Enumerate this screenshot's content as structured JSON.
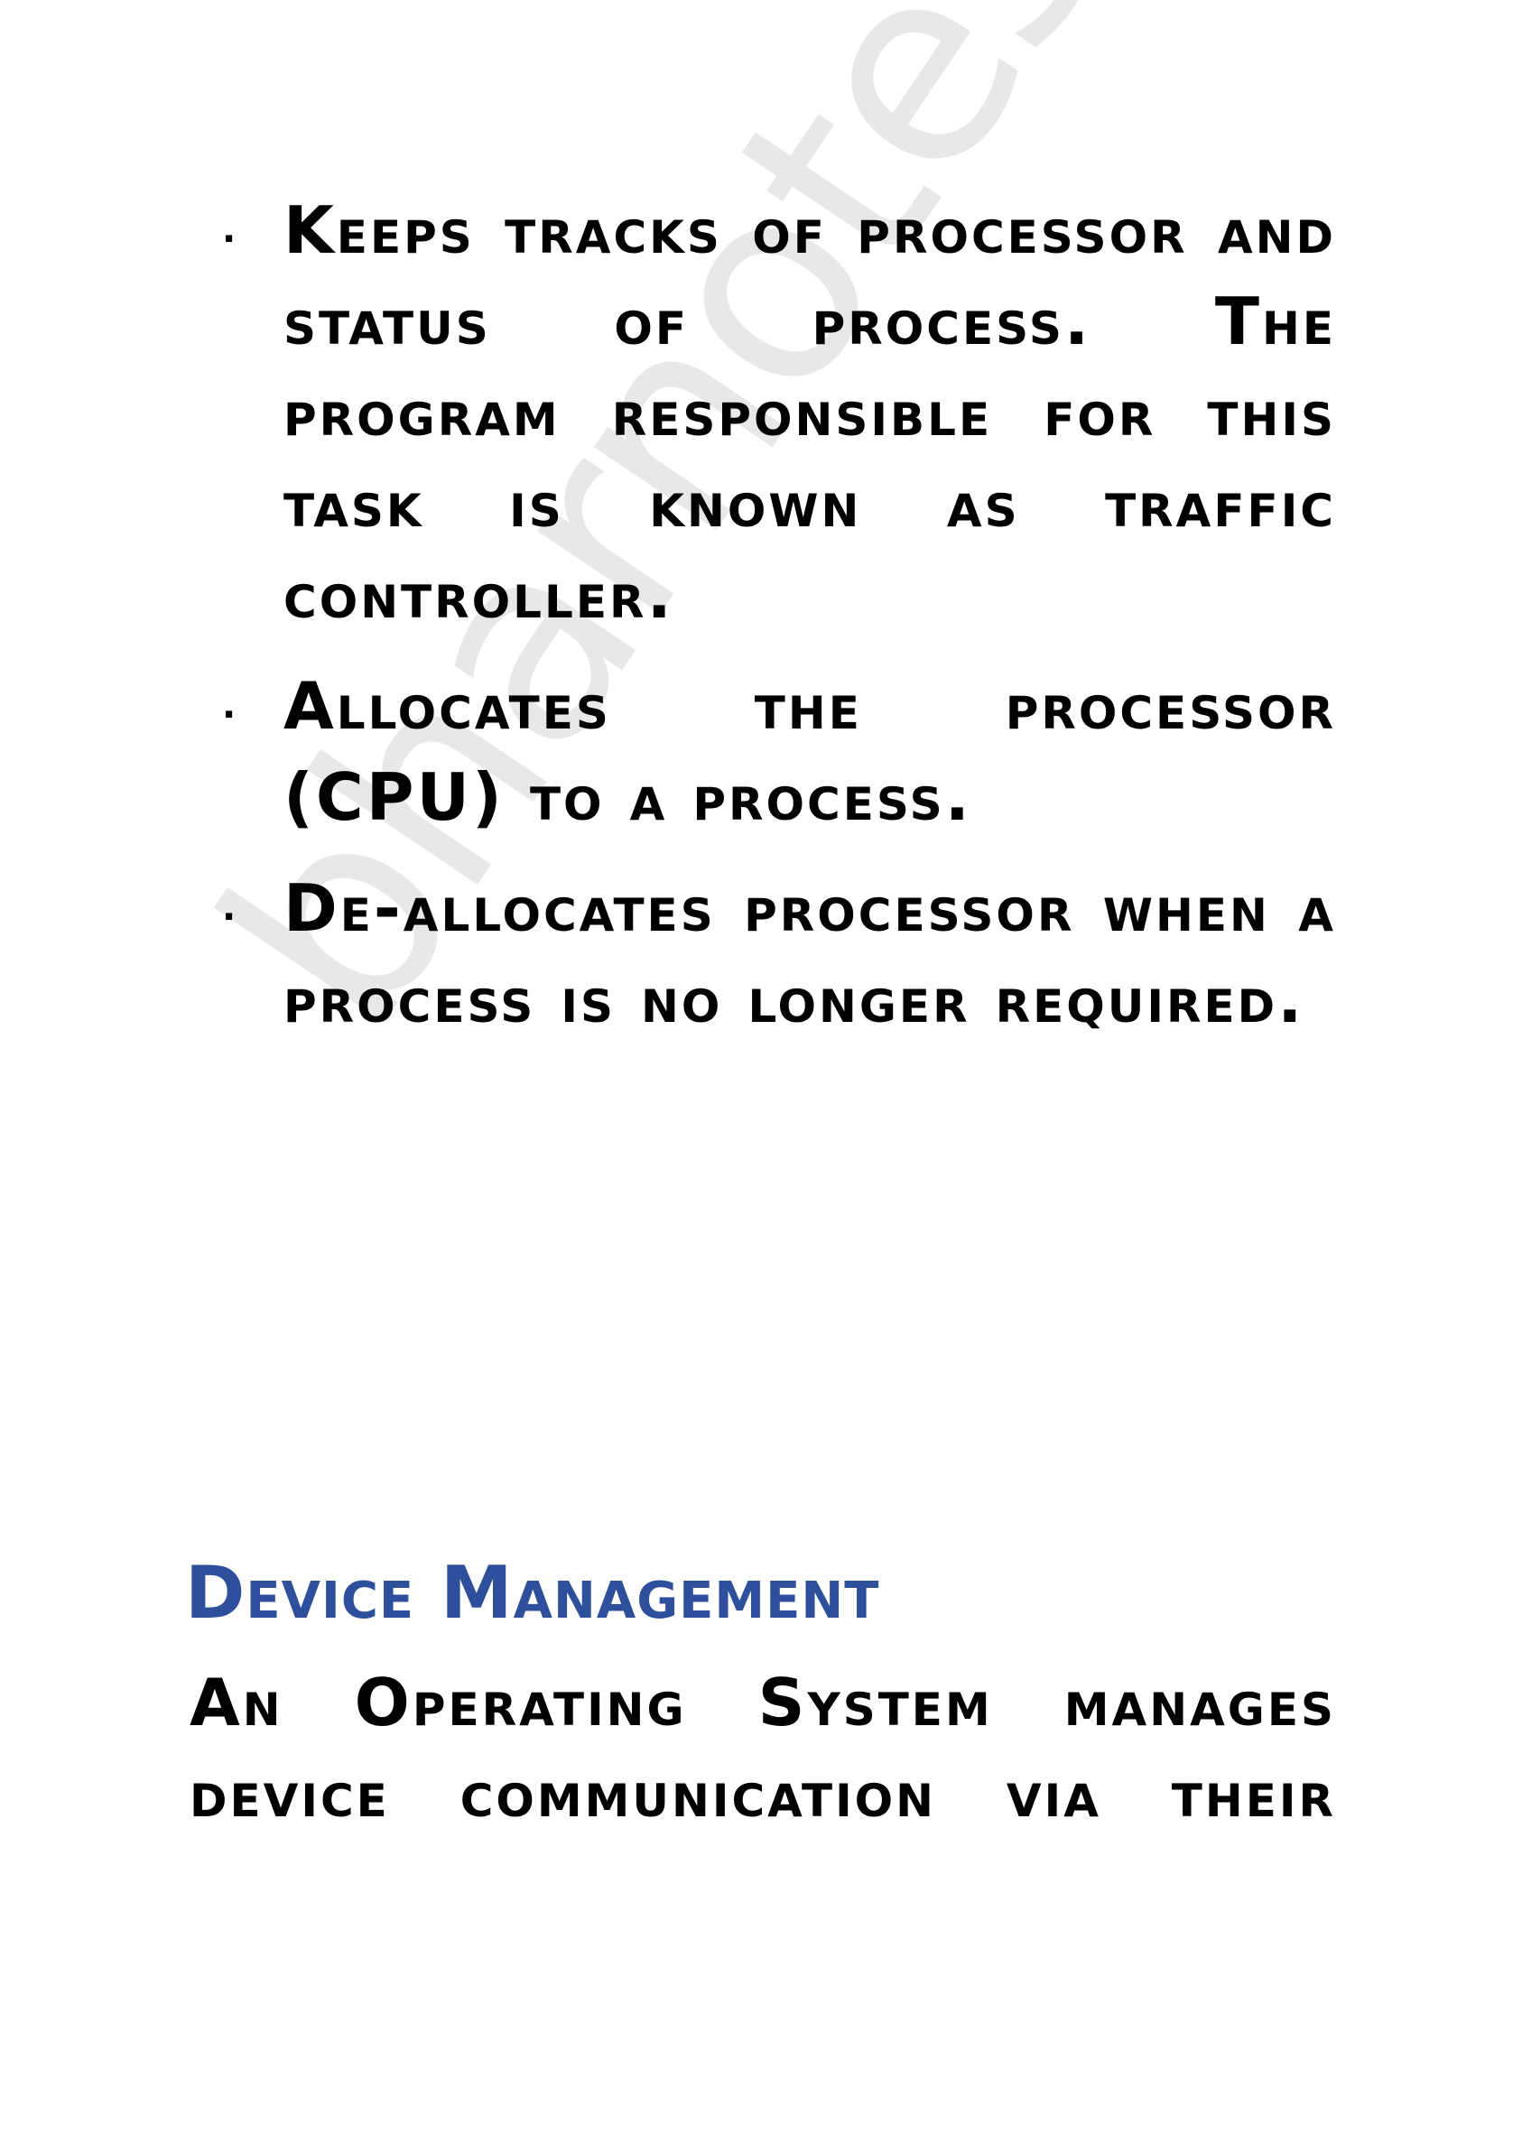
{
  "watermark": "bharnotes",
  "bullets": [
    {
      "lead": "Keeps",
      "text": " tracks of processor and status of process. The program responsible for this task is known as ",
      "bold_tail": "traffic controller."
    },
    {
      "lead": "Allocates",
      "text": " the processor (CPU) to a process.",
      "bold_tail": ""
    },
    {
      "lead": "De-allocates",
      "text": " processor when a process is no longer required.",
      "bold_tail": ""
    }
  ],
  "bullet_symbol": ".",
  "section_heading": "Device Management",
  "body_text": "An Operating System manages device communication via their",
  "colors": {
    "heading": "#2E4F9B",
    "text": "#000000",
    "background": "#ffffff"
  }
}
